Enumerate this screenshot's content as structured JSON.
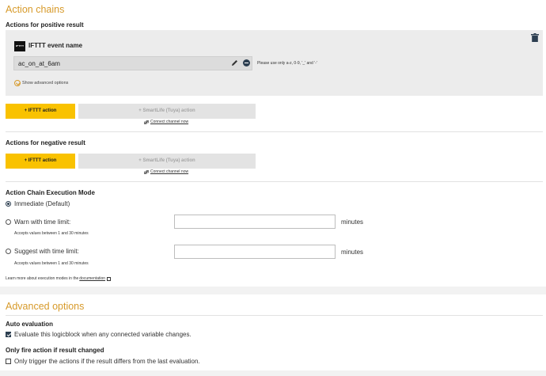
{
  "action_chains": {
    "title": "Action chains",
    "positive": {
      "title": "Actions for positive result",
      "ifttt": {
        "logo_text": "IFTTT",
        "title": "IFTTT event name",
        "event_value": "ac_on_at_6am",
        "hint": "Please use only a-z, 0-9, '_' and '-'",
        "advanced_link": "Show advanced options"
      },
      "ifttt_button": "+ IFTTT action",
      "smartlife_button": "+ SmartLife (Tuya) action",
      "connect_link": "Connect channel now"
    },
    "negative": {
      "title": "Actions for negative result",
      "ifttt_button": "+ IFTTT action",
      "smartlife_button": "+ SmartLife (Tuya) action",
      "connect_link": "Connect channel now"
    }
  },
  "execution_mode": {
    "title": "Action Chain Execution Mode",
    "selected": "immediate",
    "options": [
      {
        "label": "Immediate (Default)"
      },
      {
        "label": "Warn with time limit:",
        "unit": "minutes",
        "accepts": "Accepts values between 1 and 30 minutes",
        "value": ""
      },
      {
        "label": "Suggest with time limit:",
        "unit": "minutes",
        "accepts": "Accepts values between 1 and 30 minutes",
        "value": ""
      }
    ],
    "learn_prefix": "Learn more about execution modes in the",
    "learn_link": "documentation"
  },
  "advanced_options": {
    "title": "Advanced options",
    "auto_evaluation": {
      "title": "Auto evaluation",
      "label": "Evaluate this logicblock when any connected variable changes.",
      "checked": true
    },
    "only_fire": {
      "title": "Only fire action if result changed",
      "label": "Only trigger the actions if the result differs from the last evaluation.",
      "checked": false
    }
  },
  "colors": {
    "accent": "#d79a2a",
    "button_yellow": "#f9c200",
    "panel_gray": "#ececec",
    "checked": "#2c3e50"
  },
  "icons": [
    "trash-icon",
    "pencil-icon",
    "minus-circle-icon",
    "chevron-down-icon",
    "link-icon",
    "external-link-icon"
  ]
}
